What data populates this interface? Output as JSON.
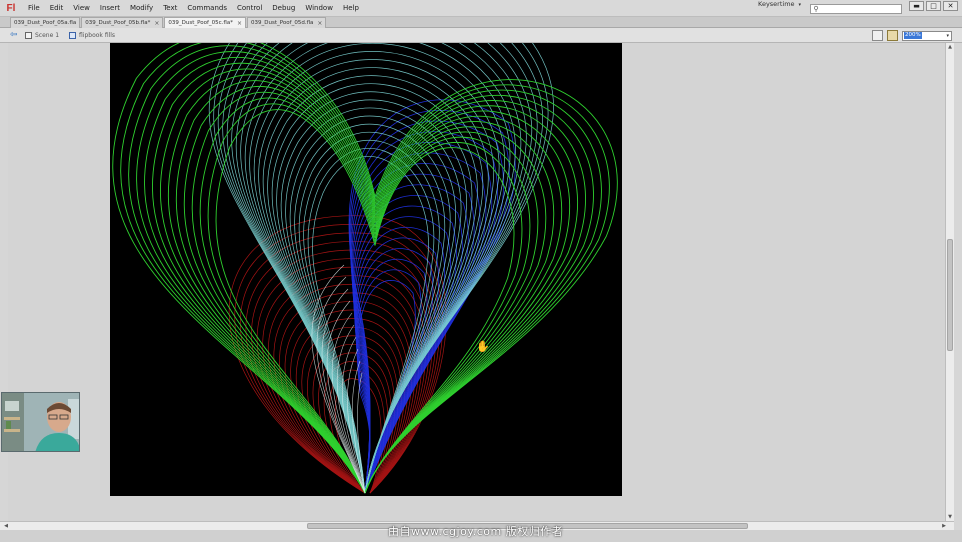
{
  "app": {
    "logo": "Fl"
  },
  "menu": [
    "File",
    "Edit",
    "View",
    "Insert",
    "Modify",
    "Text",
    "Commands",
    "Control",
    "Debug",
    "Window",
    "Help"
  ],
  "workspace": {
    "label": "Keysertime",
    "caret": "▾"
  },
  "search": {
    "value": "",
    "placeholder": ""
  },
  "window_controls": {
    "minimize": "▬",
    "restore": "□",
    "close": "✕"
  },
  "tabs": [
    {
      "label": "039_Dust_Poof_05a.fla",
      "close": "×",
      "active": false
    },
    {
      "label": "039_Dust_Poof_05b.fla*",
      "close": "×",
      "active": false
    },
    {
      "label": "039_Dust_Poof_05c.fla*",
      "close": "×",
      "active": true
    },
    {
      "label": "039_Dust_Poof_05d.fla",
      "close": "×",
      "active": false
    }
  ],
  "editbar": {
    "breadcrumb": [
      {
        "label": "Scene 1"
      },
      {
        "label": "flipbook fills"
      }
    ],
    "zoom": "200%",
    "zoom_caret": "▾"
  },
  "colors": {
    "stage": "#000000",
    "curve_green": "#2fd12f",
    "curve_cyan": "#7fd8d8",
    "curve_blue": "#2233ee",
    "curve_red": "#c21818",
    "curve_white": "#e8f4f4"
  },
  "watermark": "由自www.cgjoy.com 版权归作者"
}
